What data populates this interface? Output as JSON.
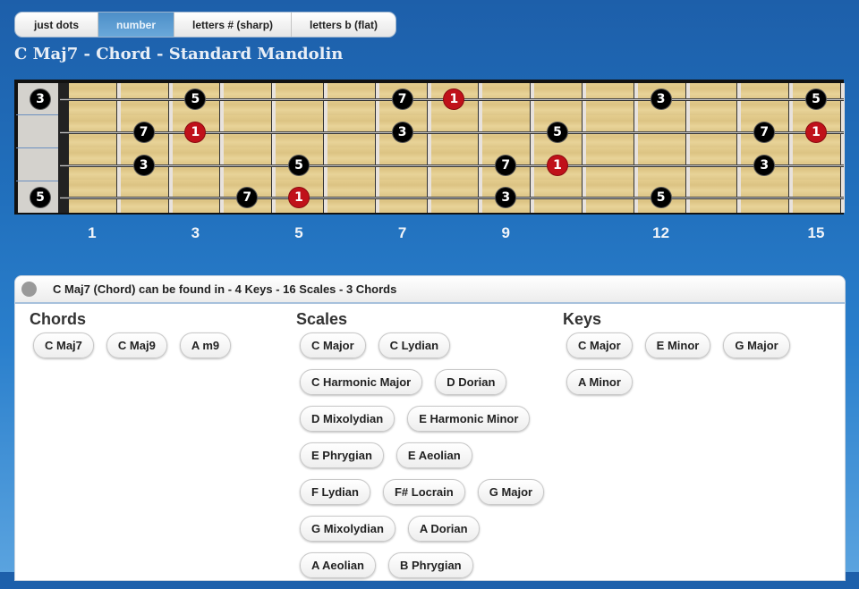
{
  "display_modes": {
    "options": [
      "just dots",
      "number",
      "letters # (sharp)",
      "letters b (flat)"
    ],
    "selected": "number"
  },
  "title": "C Maj7 - Chord - Standard Mandolin",
  "fretboard": {
    "strings": 4,
    "frets_shown": 15,
    "fret_markers": [
      "1",
      "3",
      "5",
      "7",
      "9",
      "12",
      "15"
    ],
    "notes": [
      {
        "string": 1,
        "fret": 0,
        "label": "3",
        "root": false
      },
      {
        "string": 1,
        "fret": 3,
        "label": "5",
        "root": false
      },
      {
        "string": 1,
        "fret": 7,
        "label": "7",
        "root": false
      },
      {
        "string": 1,
        "fret": 8,
        "label": "1",
        "root": true
      },
      {
        "string": 1,
        "fret": 12,
        "label": "3",
        "root": false
      },
      {
        "string": 1,
        "fret": 15,
        "label": "5",
        "root": false
      },
      {
        "string": 2,
        "fret": 2,
        "label": "7",
        "root": false
      },
      {
        "string": 2,
        "fret": 3,
        "label": "1",
        "root": true
      },
      {
        "string": 2,
        "fret": 7,
        "label": "3",
        "root": false
      },
      {
        "string": 2,
        "fret": 10,
        "label": "5",
        "root": false
      },
      {
        "string": 2,
        "fret": 14,
        "label": "7",
        "root": false
      },
      {
        "string": 2,
        "fret": 15,
        "label": "1",
        "root": true
      },
      {
        "string": 3,
        "fret": 2,
        "label": "3",
        "root": false
      },
      {
        "string": 3,
        "fret": 5,
        "label": "5",
        "root": false
      },
      {
        "string": 3,
        "fret": 9,
        "label": "7",
        "root": false
      },
      {
        "string": 3,
        "fret": 10,
        "label": "1",
        "root": true
      },
      {
        "string": 3,
        "fret": 14,
        "label": "3",
        "root": false
      },
      {
        "string": 4,
        "fret": 0,
        "label": "5",
        "root": false
      },
      {
        "string": 4,
        "fret": 4,
        "label": "7",
        "root": false
      },
      {
        "string": 4,
        "fret": 5,
        "label": "1",
        "root": true
      },
      {
        "string": 4,
        "fret": 9,
        "label": "3",
        "root": false
      },
      {
        "string": 4,
        "fret": 12,
        "label": "5",
        "root": false
      }
    ],
    "colors": {
      "root": "#c0111a",
      "note": "#000000"
    }
  },
  "found_in": {
    "header": "C Maj7 (Chord) can be found in - 4 Keys - 16 Scales - 3 Chords",
    "chords": {
      "heading": "Chords",
      "items": [
        "C Maj7",
        "C Maj9",
        "A m9"
      ]
    },
    "scales": {
      "heading": "Scales",
      "items": [
        "C Major",
        "C Lydian",
        "C Harmonic Major",
        "D Dorian",
        "D Mixolydian",
        "E Harmonic Minor",
        "E Phrygian",
        "E Aeolian",
        "F Lydian",
        "F# Locrain",
        "G Major",
        "G Mixolydian",
        "A Dorian",
        "A Aeolian",
        "B Phrygian"
      ]
    },
    "keys": {
      "heading": "Keys",
      "items": [
        "C Major",
        "E Minor",
        "G Major",
        "A Minor"
      ]
    }
  }
}
